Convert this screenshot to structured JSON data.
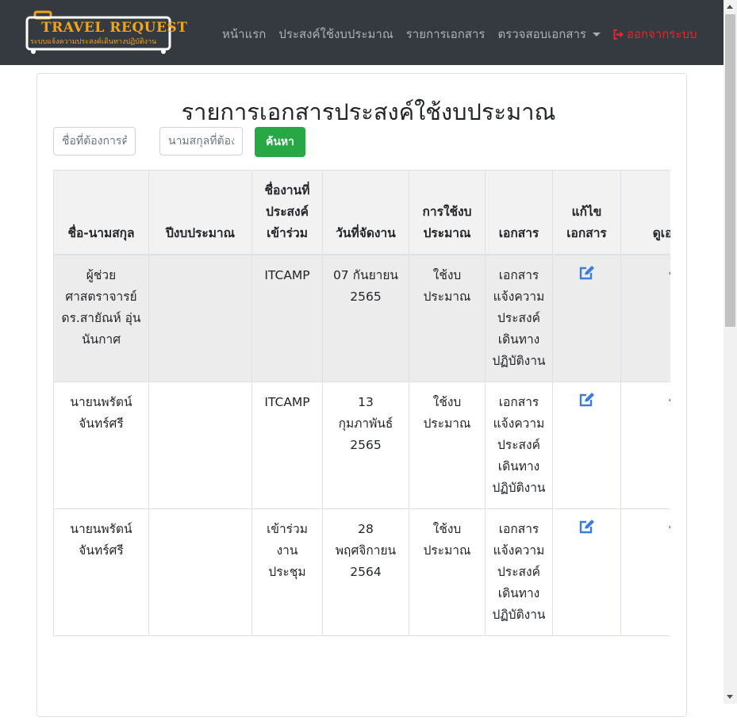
{
  "brand": {
    "title": "TRAVEL REQUEST",
    "subtitle": "ระบบแจ้งความประสงค์เดินทางปฏิบัติงาน"
  },
  "nav": {
    "home": "หน้าแรก",
    "budget_intent": "ประสงค์ใช้งบประมาณ",
    "documents": "รายการเอกสาร",
    "check_documents": "ตรวจสอบเอกสาร",
    "logout": "ออกจากระบบ"
  },
  "page": {
    "title": "รายการเอกสารประสงค์ใช้งบประมาณ"
  },
  "search": {
    "first_name_placeholder": "ชื่อที่ต้องการค้นหา",
    "last_name_placeholder": "นามสกุลที่ต้องการค้นหา",
    "button": "ค้นหา"
  },
  "table": {
    "headers": [
      "ชื่อ-นามสกุล",
      "ปีงบประมาณ",
      "ชื่องานที่ประสงค์เข้าร่วม",
      "วันที่จัดงาน",
      "การใช้งบประมาณ",
      "เอกสาร",
      "แก้ไขเอกสาร",
      "ดูเอกสาร"
    ],
    "rows": [
      {
        "name": "ผู้ช่วยศาสตราจารย์ดร.สายัณห์ อุ่นนันกาศ",
        "fiscal_year": "",
        "event": "ITCAMP",
        "date": "07 กันยายน 2565",
        "budget_use": "ใช้งบประมาณ",
        "document": "เอกสารแจ้งความประสงค์เดินทางปฏิบัติงาน"
      },
      {
        "name": "นายนพรัตน์ จันทร์ศรี",
        "fiscal_year": "",
        "event": "ITCAMP",
        "date": "13 กุมภาพันธ์ 2565",
        "budget_use": "ใช้งบประมาณ",
        "document": "เอกสารแจ้งความประสงค์เดินทางปฏิบัติงาน"
      },
      {
        "name": "นายนพรัตน์ จันทร์ศรี",
        "fiscal_year": "",
        "event": "เข้าร่วมงานประชุม",
        "date": "28 พฤศจิกายน 2564",
        "budget_use": "ใช้งบประมาณ",
        "document": "เอกสารแจ้งความประสงค์เดินทางปฏิบัติงาน"
      }
    ]
  },
  "icons": {
    "edit": "edit-icon",
    "view": "eye-icon",
    "logout": "sign-out-icon"
  },
  "colors": {
    "navbar": "#343a40",
    "brand": "#f0a41e",
    "logout": "#e8252b",
    "search_button": "#28a745",
    "icon_blue": "#3b7ddd"
  }
}
